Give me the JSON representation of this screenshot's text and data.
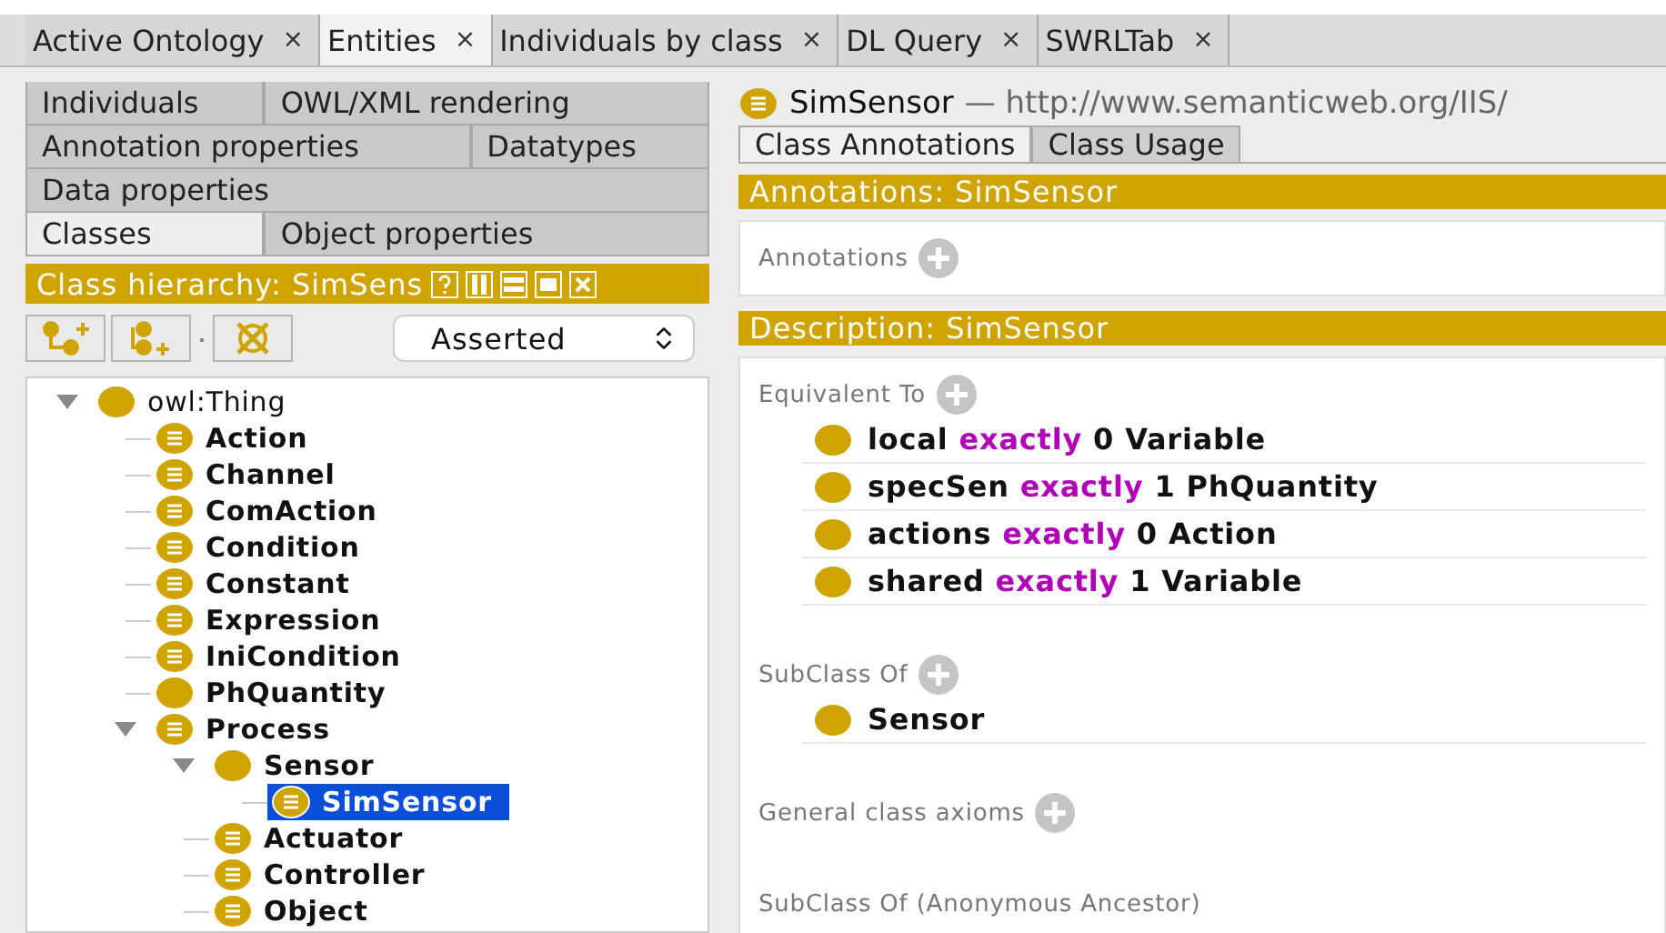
{
  "main_tabs": [
    {
      "label": "Active Ontology",
      "close": "×",
      "selected": false
    },
    {
      "label": "Entities",
      "close": "×",
      "selected": true
    },
    {
      "label": "Individuals by class",
      "close": "×",
      "selected": false
    },
    {
      "label": "DL Query",
      "close": "×",
      "selected": false
    },
    {
      "label": "SWRLTab",
      "close": "×",
      "selected": false
    }
  ],
  "entity_tabs": [
    [
      {
        "label": "Individuals",
        "selected": false
      },
      {
        "label": "OWL/XML rendering",
        "selected": false
      }
    ],
    [
      {
        "label": "Annotation properties",
        "selected": false
      },
      {
        "label": "Datatypes",
        "selected": false
      }
    ],
    [
      {
        "label": "Data properties",
        "selected": false
      }
    ],
    [
      {
        "label": "Classes",
        "selected": true
      },
      {
        "label": "Object properties",
        "selected": false
      }
    ]
  ],
  "hierarchy": {
    "title": "Class hierarchy: SimSens",
    "view": "Asserted",
    "tree": [
      {
        "label": "owl:Thing",
        "kind": "primitive",
        "expanded": true,
        "selected": false,
        "children": [
          {
            "label": "Action",
            "kind": "defined",
            "selected": false
          },
          {
            "label": "Channel",
            "kind": "defined",
            "selected": false
          },
          {
            "label": "ComAction",
            "kind": "defined",
            "selected": false
          },
          {
            "label": "Condition",
            "kind": "defined",
            "selected": false
          },
          {
            "label": "Constant",
            "kind": "defined",
            "selected": false
          },
          {
            "label": "Expression",
            "kind": "defined",
            "selected": false
          },
          {
            "label": "IniCondition",
            "kind": "defined",
            "selected": false
          },
          {
            "label": "PhQuantity",
            "kind": "primitive",
            "selected": false
          },
          {
            "label": "Process",
            "kind": "defined",
            "expanded": true,
            "selected": false,
            "children": [
              {
                "label": "Sensor",
                "kind": "primitive",
                "expanded": true,
                "selected": false,
                "children": [
                  {
                    "label": "SimSensor",
                    "kind": "defined",
                    "selected": true
                  }
                ]
              },
              {
                "label": "Actuator",
                "kind": "defined",
                "selected": false
              },
              {
                "label": "Controller",
                "kind": "defined",
                "selected": false
              },
              {
                "label": "Object",
                "kind": "defined",
                "selected": false
              }
            ]
          }
        ]
      }
    ]
  },
  "entity": {
    "name": "SimSensor",
    "iri": "— http://www.semanticweb.org/IIS/",
    "tabs": [
      {
        "label": "Class Annotations",
        "selected": true
      },
      {
        "label": "Class Usage",
        "selected": false
      }
    ],
    "annotations_title": "Annotations: SimSensor",
    "annotations_label": "Annotations",
    "description_title": "Description: SimSensor",
    "sections": [
      {
        "label": "Equivalent To",
        "items": [
          {
            "kind": "restriction",
            "property": "local",
            "keyword": "exactly",
            "cardinality": "0",
            "filler": "Variable"
          },
          {
            "kind": "restriction",
            "property": "specSen",
            "keyword": "exactly",
            "cardinality": "1",
            "filler": "PhQuantity"
          },
          {
            "kind": "restriction",
            "property": "actions",
            "keyword": "exactly",
            "cardinality": "0",
            "filler": "Action"
          },
          {
            "kind": "restriction",
            "property": "shared",
            "keyword": "exactly",
            "cardinality": "1",
            "filler": "Variable"
          }
        ]
      },
      {
        "label": "SubClass Of",
        "items": [
          {
            "kind": "class",
            "property": "Sensor"
          }
        ]
      },
      {
        "label": "General class axioms"
      },
      {
        "label": "SubClass Of (Anonymous Ancestor)"
      }
    ]
  }
}
